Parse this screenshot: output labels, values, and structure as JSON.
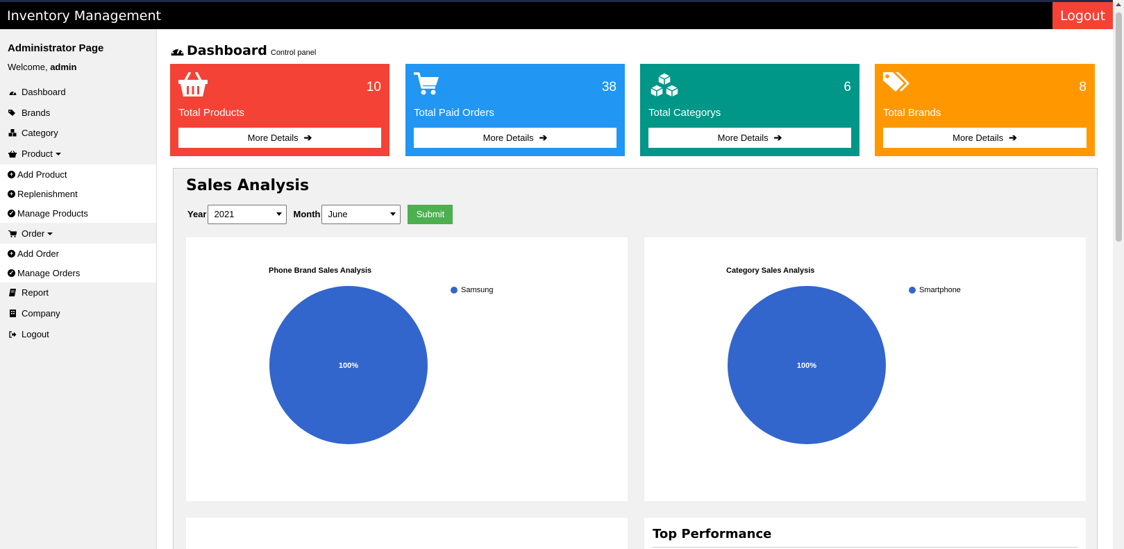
{
  "app": {
    "title": "Inventory Management",
    "logout_label": "Logout"
  },
  "sidebar": {
    "title": "Administrator Page",
    "welcome_prefix": "Welcome,",
    "username": "admin",
    "items": {
      "dashboard": "Dashboard",
      "brands": "Brands",
      "category": "Category",
      "product": "Product",
      "add_product": "Add Product",
      "replenishment": "Replenishment",
      "manage_products": "Manage Products",
      "order": "Order",
      "add_order": "Add Order",
      "manage_orders": "Manage Orders",
      "report": "Report",
      "company": "Company",
      "logout": "Logout"
    }
  },
  "page": {
    "title": "Dashboard",
    "subtitle": "Control panel"
  },
  "cards": [
    {
      "count": "10",
      "label": "Total Products",
      "more": "More Details",
      "color": "#f44336",
      "icon": "basket-icon"
    },
    {
      "count": "38",
      "label": "Total Paid Orders",
      "more": "More Details",
      "color": "#2196f3",
      "icon": "cart-icon"
    },
    {
      "count": "6",
      "label": "Total Categorys",
      "more": "More Details",
      "color": "#009688",
      "icon": "cubes-icon"
    },
    {
      "count": "8",
      "label": "Total Brands",
      "more": "More Details",
      "color": "#ff9800",
      "icon": "tags-icon"
    }
  ],
  "sales": {
    "title": "Sales Analysis",
    "year_label": "Year",
    "year_value": "2021",
    "month_label": "Month",
    "month_value": "June",
    "submit_label": "Submit"
  },
  "chart_data": [
    {
      "type": "pie",
      "title": "Phone Brand Sales Analysis",
      "categories": [
        "Samsung"
      ],
      "values": [
        100
      ],
      "slice_labels": [
        "100%"
      ],
      "colors": [
        "#3366cc"
      ],
      "legend": "right"
    },
    {
      "type": "pie",
      "title": "Category Sales Analysis",
      "categories": [
        "Smartphone"
      ],
      "values": [
        100
      ],
      "slice_labels": [
        "100%"
      ],
      "colors": [
        "#3366cc"
      ],
      "legend": "right"
    }
  ],
  "top_performance": {
    "title": "Top Performance"
  }
}
